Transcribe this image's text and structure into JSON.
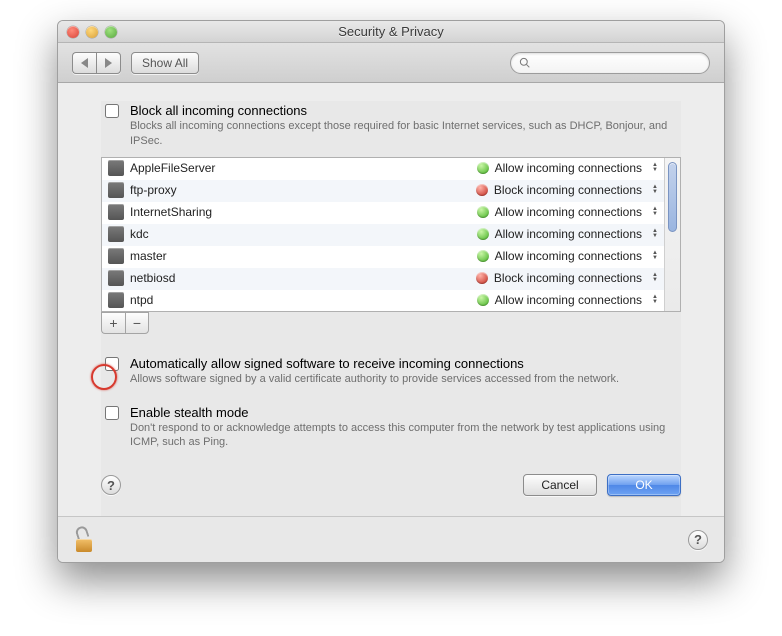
{
  "window": {
    "title": "Security & Privacy"
  },
  "toolbar": {
    "show_all": "Show All",
    "search_placeholder": ""
  },
  "block_all": {
    "label": "Block all incoming connections",
    "sub": "Blocks all incoming connections except those required for basic Internet services, such as DHCP, Bonjour, and IPSec."
  },
  "apps": [
    {
      "name": "AppleFileServer",
      "status": "Allow incoming connections",
      "color": "green"
    },
    {
      "name": "ftp-proxy",
      "status": "Block incoming connections",
      "color": "red"
    },
    {
      "name": "InternetSharing",
      "status": "Allow incoming connections",
      "color": "green"
    },
    {
      "name": "kdc",
      "status": "Allow incoming connections",
      "color": "green"
    },
    {
      "name": "master",
      "status": "Allow incoming connections",
      "color": "green"
    },
    {
      "name": "netbiosd",
      "status": "Block incoming connections",
      "color": "red"
    },
    {
      "name": "ntpd",
      "status": "Allow incoming connections",
      "color": "green"
    }
  ],
  "auto_allow": {
    "label": "Automatically allow signed software to receive incoming connections",
    "sub": "Allows software signed by a valid certificate authority to provide services accessed from the network."
  },
  "stealth": {
    "label": "Enable stealth mode",
    "sub": "Don't respond to or acknowledge attempts to access this computer from the network by test applications using ICMP, such as Ping."
  },
  "buttons": {
    "cancel": "Cancel",
    "ok": "OK"
  }
}
